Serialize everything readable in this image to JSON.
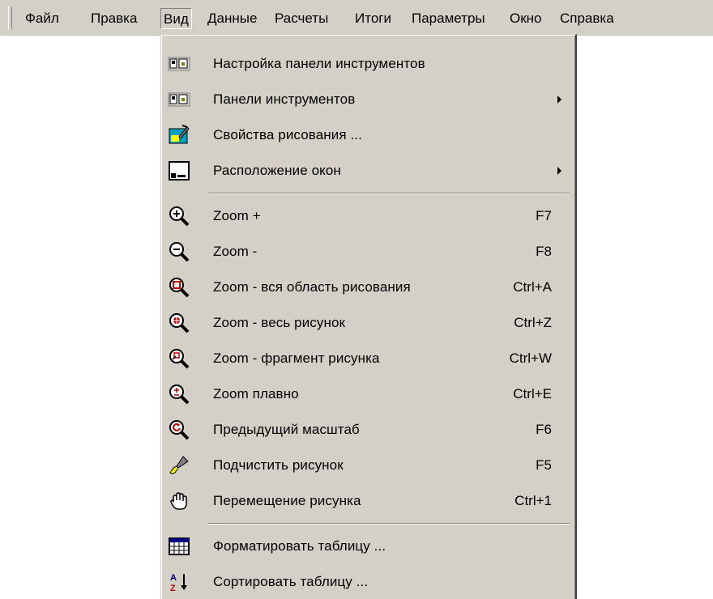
{
  "menubar": {
    "items": [
      {
        "label": "Файл"
      },
      {
        "label": "Правка"
      },
      {
        "label": "Вид"
      },
      {
        "label": "Данные"
      },
      {
        "label": "Расчеты"
      },
      {
        "label": "Итоги"
      },
      {
        "label": "Параметры"
      },
      {
        "label": "Окно"
      },
      {
        "label": "Справка"
      }
    ],
    "active": "Вид"
  },
  "menu": {
    "items": [
      {
        "label": "Настройка панели инструментов",
        "icon": "toolbar-settings-icon",
        "shortcut": ""
      },
      {
        "label": "Панели инструментов",
        "icon": "toolbars-icon",
        "shortcut": "",
        "submenu": true
      },
      {
        "label": "Свойства рисования ...",
        "icon": "drawing-properties-icon",
        "shortcut": ""
      },
      {
        "label": "Расположение окон",
        "icon": "window-layout-icon",
        "shortcut": "",
        "submenu": true
      },
      {
        "label": "Zoom +",
        "icon": "zoom-in-icon",
        "shortcut": "F7"
      },
      {
        "label": "Zoom -",
        "icon": "zoom-out-icon",
        "shortcut": "F8"
      },
      {
        "label": "Zoom - вся область рисования",
        "icon": "zoom-all-area-icon",
        "shortcut": "Ctrl+A"
      },
      {
        "label": "Zoom - весь рисунок",
        "icon": "zoom-whole-drawing-icon",
        "shortcut": "Ctrl+Z"
      },
      {
        "label": "Zoom - фрагмент рисунка",
        "icon": "zoom-fragment-icon",
        "shortcut": "Ctrl+W"
      },
      {
        "label": "Zoom плавно",
        "icon": "zoom-smooth-icon",
        "shortcut": "Ctrl+E"
      },
      {
        "label": "Предыдущий масштаб",
        "icon": "zoom-previous-icon",
        "shortcut": "F6"
      },
      {
        "label": "Подчистить рисунок",
        "icon": "brush-icon",
        "shortcut": "F5"
      },
      {
        "label": "Перемещение рисунка",
        "icon": "hand-pan-icon",
        "shortcut": "Ctrl+1"
      },
      {
        "label": "Форматировать таблицу ...",
        "icon": "table-format-icon",
        "shortcut": ""
      },
      {
        "label": "Сортировать таблицу ...",
        "icon": "sort-az-icon",
        "shortcut": ""
      }
    ]
  },
  "colors": {
    "face": "#d4d0c8",
    "shadow": "#808080",
    "highlight": "#ffffff",
    "icon_blue": "#000080",
    "icon_red": "#c00000"
  }
}
